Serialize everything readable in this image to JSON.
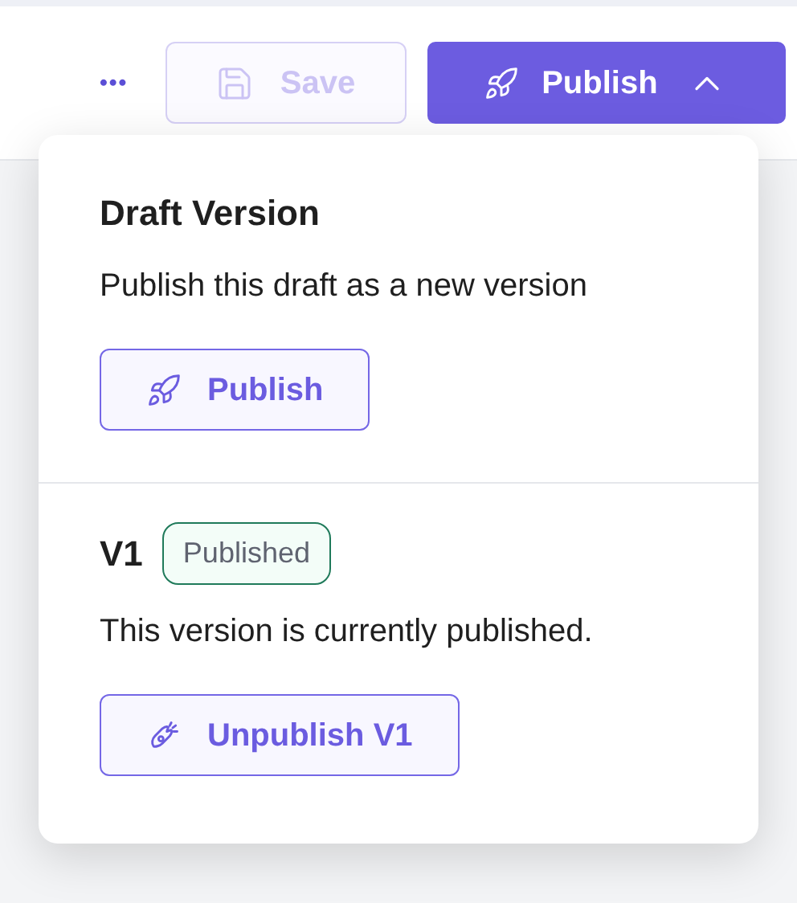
{
  "toolbar": {
    "more": "•••",
    "save": {
      "label": "Save",
      "disabled": true
    },
    "publish": {
      "label": "Publish",
      "expanded": true
    }
  },
  "menu": {
    "sections": [
      {
        "kind": "draft",
        "title": "Draft Version",
        "description": "Publish this draft as a new version",
        "action": "Publish"
      },
      {
        "kind": "version",
        "title": "V1",
        "badge": "Published",
        "description": "This version is currently published.",
        "action": "Unpublish V1"
      }
    ]
  }
}
